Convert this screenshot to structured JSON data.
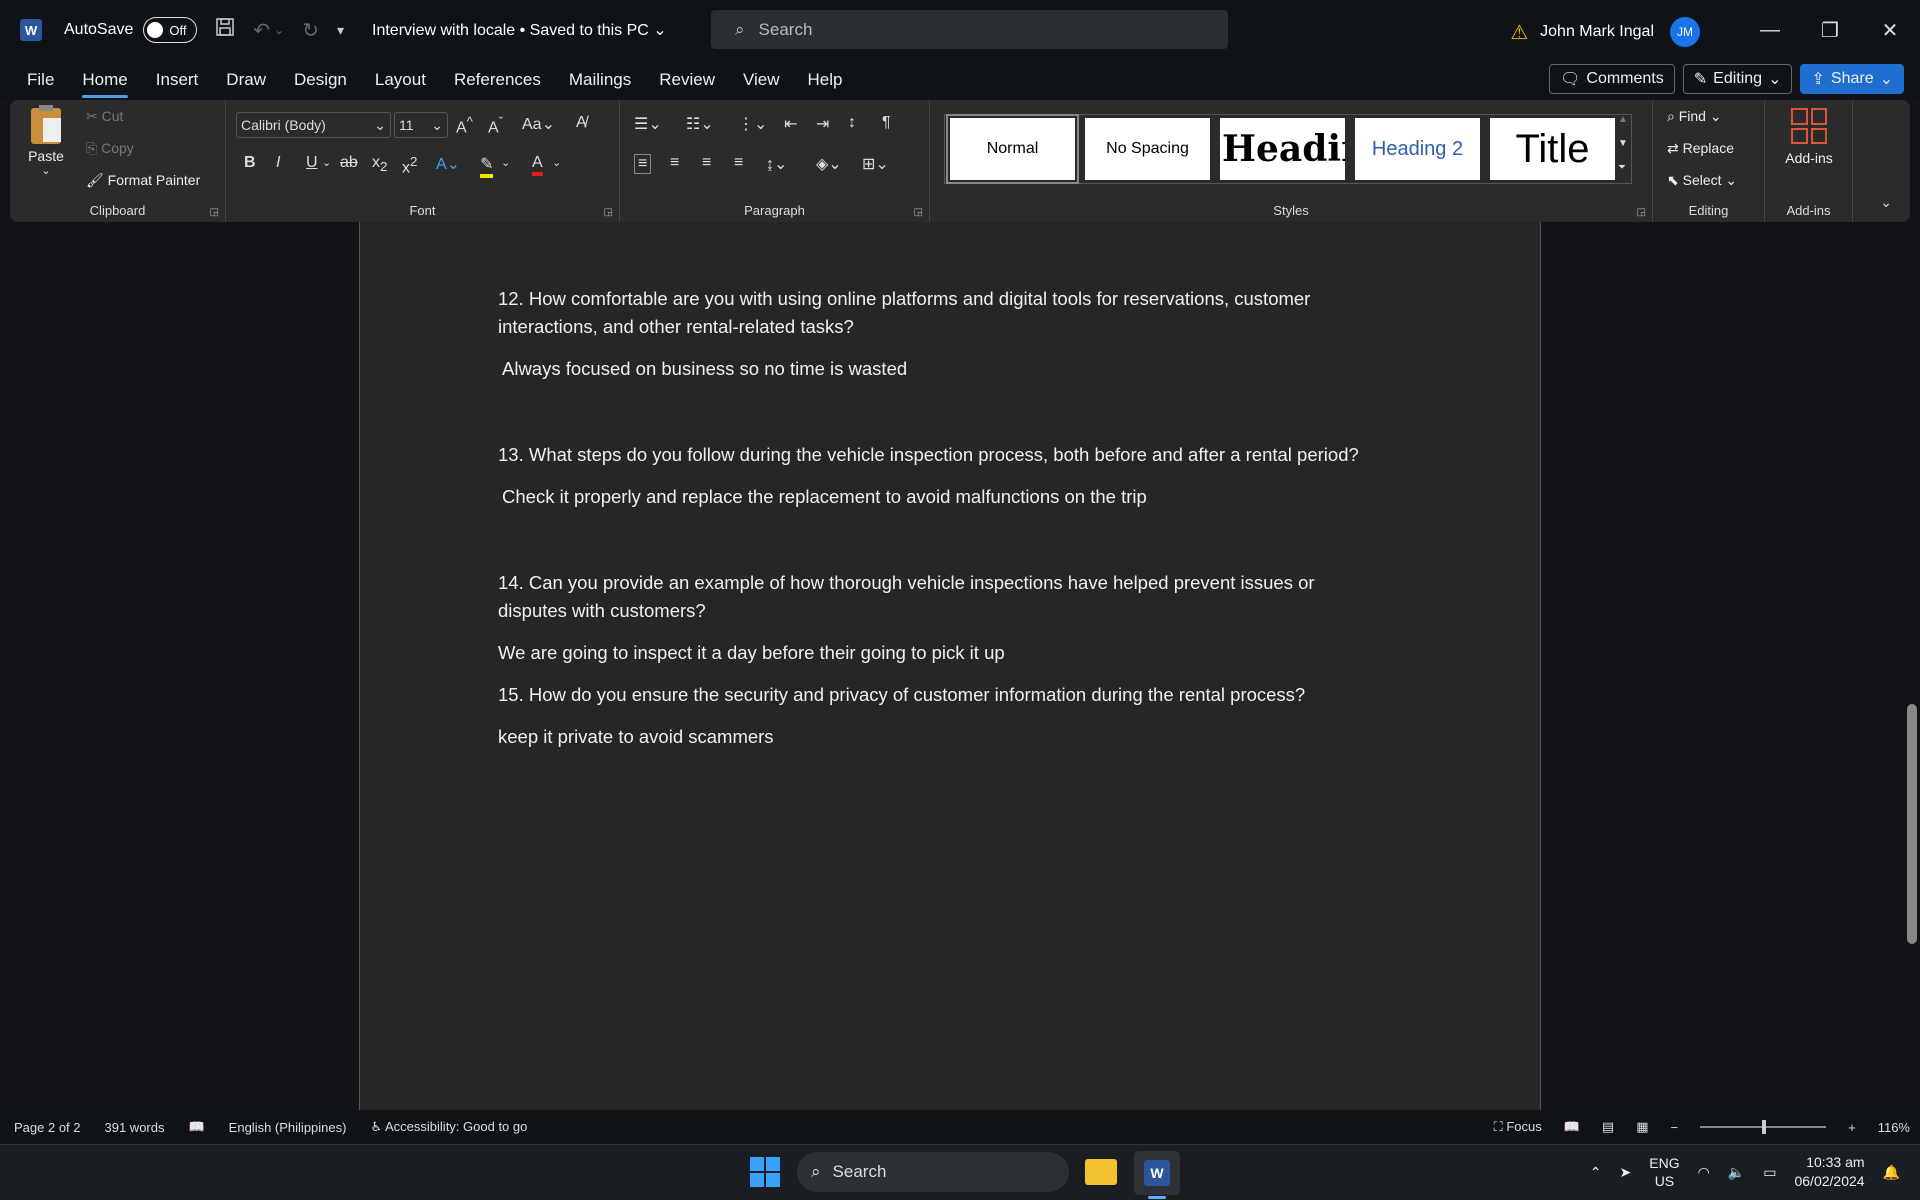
{
  "titlebar": {
    "autosave_label": "AutoSave",
    "autosave_state": "Off",
    "doc_title": "Interview with locale • Saved to this PC",
    "search_placeholder": "Search",
    "user_name": "John Mark Ingal",
    "user_initials": "JM"
  },
  "tabs": [
    "File",
    "Home",
    "Insert",
    "Draw",
    "Design",
    "Layout",
    "References",
    "Mailings",
    "Review",
    "View",
    "Help"
  ],
  "tab_buttons": {
    "comments": "Comments",
    "editing": "Editing",
    "share": "Share"
  },
  "ribbon": {
    "clipboard": {
      "paste": "Paste",
      "cut": "Cut",
      "copy": "Copy",
      "format_painter": "Format Painter",
      "label": "Clipboard"
    },
    "font": {
      "font_name": "Calibri (Body)",
      "font_size": "11",
      "label": "Font"
    },
    "paragraph": {
      "label": "Paragraph"
    },
    "styles": {
      "items": [
        "Normal",
        "No Spacing",
        "Headin",
        "Heading 2",
        "Title"
      ],
      "label": "Styles"
    },
    "editing": {
      "find": "Find",
      "replace": "Replace",
      "select": "Select",
      "label": "Editing"
    },
    "addins": {
      "button": "Add-ins",
      "label": "Add-ins"
    }
  },
  "document": {
    "q12": "12. How comfortable are you with using online platforms and digital tools for reservations, customer interactions, and other rental-related tasks?",
    "a12": "Always focused on business so no time is wasted",
    "q13": "13. What steps do you follow during the vehicle inspection process, both before and after a rental period?",
    "a13": "Check it properly and replace the replacement to avoid malfunctions on the trip",
    "q14": "14. Can you provide an example of how thorough vehicle inspections have helped prevent issues or disputes with customers?",
    "a14": "We are going to inspect it a day before their going to pick it up",
    "q15": "15. How do you ensure the security and privacy of customer information during the rental process?",
    "a15": "keep it private to avoid scammers"
  },
  "statusbar": {
    "page": "Page 2 of 2",
    "words": "391 words",
    "language": "English (Philippines)",
    "accessibility": "Accessibility: Good to go",
    "focus": "Focus",
    "zoom": "116%"
  },
  "taskbar": {
    "search": "Search",
    "lang_top": "ENG",
    "lang_bottom": "US",
    "time": "10:33 am",
    "date": "06/02/2024"
  },
  "colors": {
    "accent": "#1e6fd0",
    "warning": "#f2b400",
    "page_bg": "#262626"
  }
}
